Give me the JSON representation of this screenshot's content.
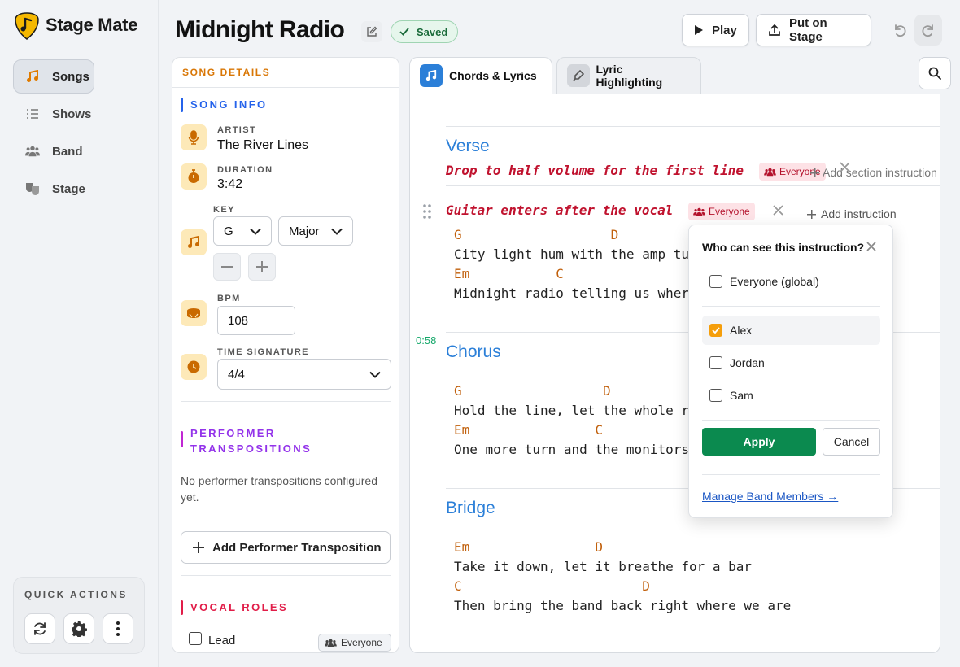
{
  "app": {
    "name": "Stage Mate"
  },
  "nav": {
    "items": [
      {
        "label": "Songs",
        "icon": "music-note-icon",
        "active": true
      },
      {
        "label": "Shows",
        "icon": "list-icon",
        "active": false
      },
      {
        "label": "Band",
        "icon": "people-icon",
        "active": false
      },
      {
        "label": "Stage",
        "icon": "theater-masks-icon",
        "active": false
      }
    ]
  },
  "quick_actions": {
    "title": "QUICK ACTIONS",
    "buttons": [
      "refresh-icon",
      "gear-icon",
      "more-vertical-icon"
    ]
  },
  "header": {
    "title": "Midnight Radio",
    "saved_label": "Saved",
    "play_label": "Play",
    "stage_label": "Put on Stage"
  },
  "details": {
    "heading": "SONG DETAILS",
    "song_info": {
      "title": "SONG INFO",
      "artist_label": "ARTIST",
      "artist": "The River Lines",
      "duration_label": "DURATION",
      "duration": "3:42",
      "key_label": "KEY",
      "key": "G",
      "mode": "Major",
      "bpm_label": "BPM",
      "bpm": "108",
      "time_sig_label": "TIME SIGNATURE",
      "time_sig": "4/4"
    },
    "transpositions": {
      "title_line1": "PERFORMER",
      "title_line2": "TRANSPOSITIONS",
      "empty": "No performer transpositions configured yet.",
      "add_label": "Add Performer Transposition"
    },
    "vocal_roles": {
      "title": "VOCAL ROLES",
      "roles": [
        {
          "label": "Lead",
          "visibility": "Everyone"
        }
      ]
    }
  },
  "tabs": [
    {
      "label": "Chords & Lyrics",
      "active": true
    },
    {
      "label": "Lyric Highlighting",
      "active": false
    }
  ],
  "sheet": {
    "verse": {
      "name": "Verse",
      "section_instruction": "Drop to half volume for the first line",
      "section_visibility": "Everyone",
      "add_section_instruction": "Add section instruction",
      "line_instruction": "Guitar enters after the vocal",
      "line_visibility": "Everyone",
      "add_instruction": "Add instruction",
      "lines": [
        {
          "chords": "G                   D",
          "lyrics": "City light hum with the amp tu"
        },
        {
          "chords": "Em           C",
          "lyrics": "Midnight radio telling us wher"
        }
      ]
    },
    "chorus": {
      "name": "Chorus",
      "timestamp": "0:58",
      "lines": [
        {
          "chords": "G                  D",
          "lyrics": "Hold the line, let the whole r"
        },
        {
          "chords": "Em                C",
          "lyrics": "One more turn and the monitors"
        }
      ]
    },
    "bridge": {
      "name": "Bridge",
      "lines": [
        {
          "chords": "Em                D",
          "lyrics": "Take it down, let it breathe for a bar"
        },
        {
          "chords": "C                       D",
          "lyrics": "Then bring the band back right where we are"
        }
      ]
    }
  },
  "popup": {
    "title": "Who can see this instruction?",
    "options": [
      {
        "label": "Everyone (global)",
        "checked": false
      },
      {
        "label": "Alex",
        "checked": true
      },
      {
        "label": "Jordan",
        "checked": false
      },
      {
        "label": "Sam",
        "checked": false
      }
    ],
    "apply_label": "Apply",
    "cancel_label": "Cancel",
    "manage_label": "Manage Band Members →"
  },
  "colors": {
    "accent_orange": "#d97706",
    "blue": "#2b7fd8",
    "instruction_red": "#c0122e",
    "chord_orange": "#c1600c",
    "apply_green": "#0b8a4f",
    "timestamp_green": "#14a86a"
  }
}
